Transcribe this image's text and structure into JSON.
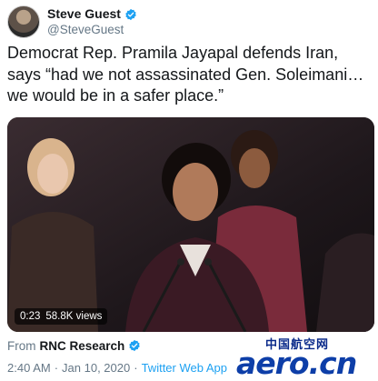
{
  "author": {
    "display_name": "Steve Guest",
    "handle": "@SteveGuest",
    "verified_icon": "verified-badge-icon"
  },
  "tweet": {
    "text": "Democrat Rep. Pramila Jayapal defends Iran, says “had we not assassinated Gen. Soleimani…we would be in a safer place.”"
  },
  "video": {
    "duration": "0:23",
    "views": "58.8K views"
  },
  "source": {
    "from_label": "From",
    "name": "RNC Research"
  },
  "meta": {
    "time": "2:40 AM",
    "separator1": "·",
    "date": "Jan 10, 2020",
    "separator2": "·",
    "app": "Twitter Web App"
  },
  "watermark": {
    "top": "中国航空网",
    "main": "aero.cn"
  },
  "colors": {
    "verified": "#1da1f2",
    "muted": "#657786",
    "link": "#1da1f2",
    "watermark": "#0d3ea8"
  }
}
